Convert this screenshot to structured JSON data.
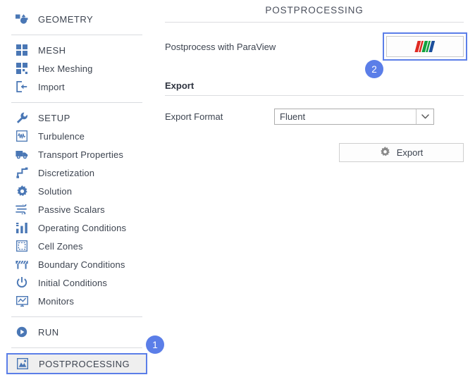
{
  "sidebar": {
    "groups": [
      {
        "items": [
          {
            "label": "GEOMETRY",
            "icon": "geometry-icon",
            "top": true,
            "selected": false
          }
        ]
      },
      {
        "items": [
          {
            "label": "MESH",
            "icon": "mesh-grid-icon",
            "top": true,
            "selected": false
          },
          {
            "label": "Hex Meshing",
            "icon": "hex-meshing-icon",
            "top": false,
            "selected": false
          },
          {
            "label": "Import",
            "icon": "import-arrow-icon",
            "top": false,
            "selected": false
          }
        ]
      },
      {
        "items": [
          {
            "label": "SETUP",
            "icon": "wrench-icon",
            "top": true,
            "selected": false
          },
          {
            "label": "Turbulence",
            "icon": "waveform-icon",
            "top": false,
            "selected": false
          },
          {
            "label": "Transport Properties",
            "icon": "truck-icon",
            "top": false,
            "selected": false
          },
          {
            "label": "Discretization",
            "icon": "steps-icon",
            "top": false,
            "selected": false
          },
          {
            "label": "Solution",
            "icon": "gear-icon",
            "top": false,
            "selected": false
          },
          {
            "label": "Passive Scalars",
            "icon": "wind-flow-icon",
            "top": false,
            "selected": false
          },
          {
            "label": "Operating Conditions",
            "icon": "bar-chart-icon",
            "top": false,
            "selected": false
          },
          {
            "label": "Cell Zones",
            "icon": "dashed-square-icon",
            "top": false,
            "selected": false
          },
          {
            "label": "Boundary Conditions",
            "icon": "barrier-fence-icon",
            "top": false,
            "selected": false
          },
          {
            "label": "Initial Conditions",
            "icon": "power-icon",
            "top": false,
            "selected": false
          },
          {
            "label": "Monitors",
            "icon": "monitor-chart-icon",
            "top": false,
            "selected": false
          }
        ]
      },
      {
        "items": [
          {
            "label": "RUN",
            "icon": "play-circle-icon",
            "top": true,
            "selected": false
          }
        ]
      },
      {
        "items": [
          {
            "label": "POSTPROCESSING",
            "icon": "postprocessing-icon",
            "top": true,
            "selected": true
          }
        ]
      }
    ]
  },
  "header": {
    "title": "POSTPROCESSING"
  },
  "main": {
    "paraview_row_label": "Postprocess with ParaView",
    "paraview_button_name": "ParaView",
    "export_section_title": "Export",
    "export_format_label": "Export Format",
    "export_format_value": "Fluent",
    "export_button_label": "Export"
  },
  "badges": [
    {
      "number": "1",
      "target": "postprocessing-sidebar-item"
    },
    {
      "number": "2",
      "target": "paraview-button"
    }
  ],
  "colors": {
    "accent_blue": "#5b7ee8",
    "icon_blue": "#4a77b5",
    "text": "#3d4450",
    "divider": "#dcdde0",
    "selected_bg": "#efefef",
    "logo_red": "#e02a22",
    "logo_green": "#12a13e",
    "logo_blue": "#1b4f9c"
  }
}
